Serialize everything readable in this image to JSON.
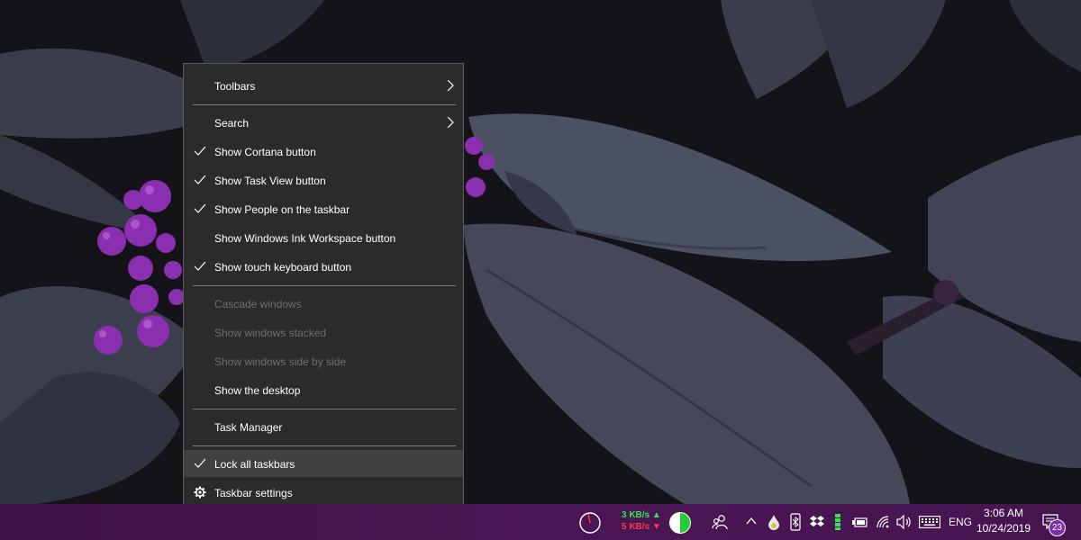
{
  "context_menu": {
    "items": [
      {
        "label": "Toolbars",
        "checked": false,
        "submenu": true,
        "disabled": false
      },
      {
        "label": "Search",
        "checked": false,
        "submenu": true,
        "disabled": false
      },
      {
        "label": "Show Cortana button",
        "checked": true,
        "submenu": false,
        "disabled": false
      },
      {
        "label": "Show Task View button",
        "checked": true,
        "submenu": false,
        "disabled": false
      },
      {
        "label": "Show People on the taskbar",
        "checked": true,
        "submenu": false,
        "disabled": false
      },
      {
        "label": "Show Windows Ink Workspace button",
        "checked": false,
        "submenu": false,
        "disabled": false
      },
      {
        "label": "Show touch keyboard button",
        "checked": true,
        "submenu": false,
        "disabled": false
      },
      {
        "label": "Cascade windows",
        "checked": false,
        "submenu": false,
        "disabled": true
      },
      {
        "label": "Show windows stacked",
        "checked": false,
        "submenu": false,
        "disabled": true
      },
      {
        "label": "Show windows side by side",
        "checked": false,
        "submenu": false,
        "disabled": true
      },
      {
        "label": "Show the desktop",
        "checked": false,
        "submenu": false,
        "disabled": false
      },
      {
        "label": "Task Manager",
        "checked": false,
        "submenu": false,
        "disabled": false
      },
      {
        "label": "Lock all taskbars",
        "checked": true,
        "submenu": false,
        "disabled": false,
        "highlighted": true
      },
      {
        "label": "Taskbar settings",
        "checked": false,
        "submenu": false,
        "disabled": false,
        "icon": "gear-icon"
      }
    ]
  },
  "taskbar": {
    "network_monitor": {
      "upload": "3 KB/s",
      "download": "5 KB/s"
    },
    "tray_icons": [
      "cpu-gauge-icon",
      "battery-pie-icon",
      "people-icon",
      "chevron-up-icon",
      "droplet-icon",
      "bluetooth-icon",
      "dropbox-icon",
      "battery-level-icon",
      "power-icon",
      "wifi-icon",
      "volume-icon",
      "keyboard-icon"
    ],
    "language": "ENG",
    "clock": {
      "time": "3:06 AM",
      "date": "10/24/2019"
    },
    "notifications": {
      "count": "23"
    },
    "accent_color": "#4a1553"
  }
}
